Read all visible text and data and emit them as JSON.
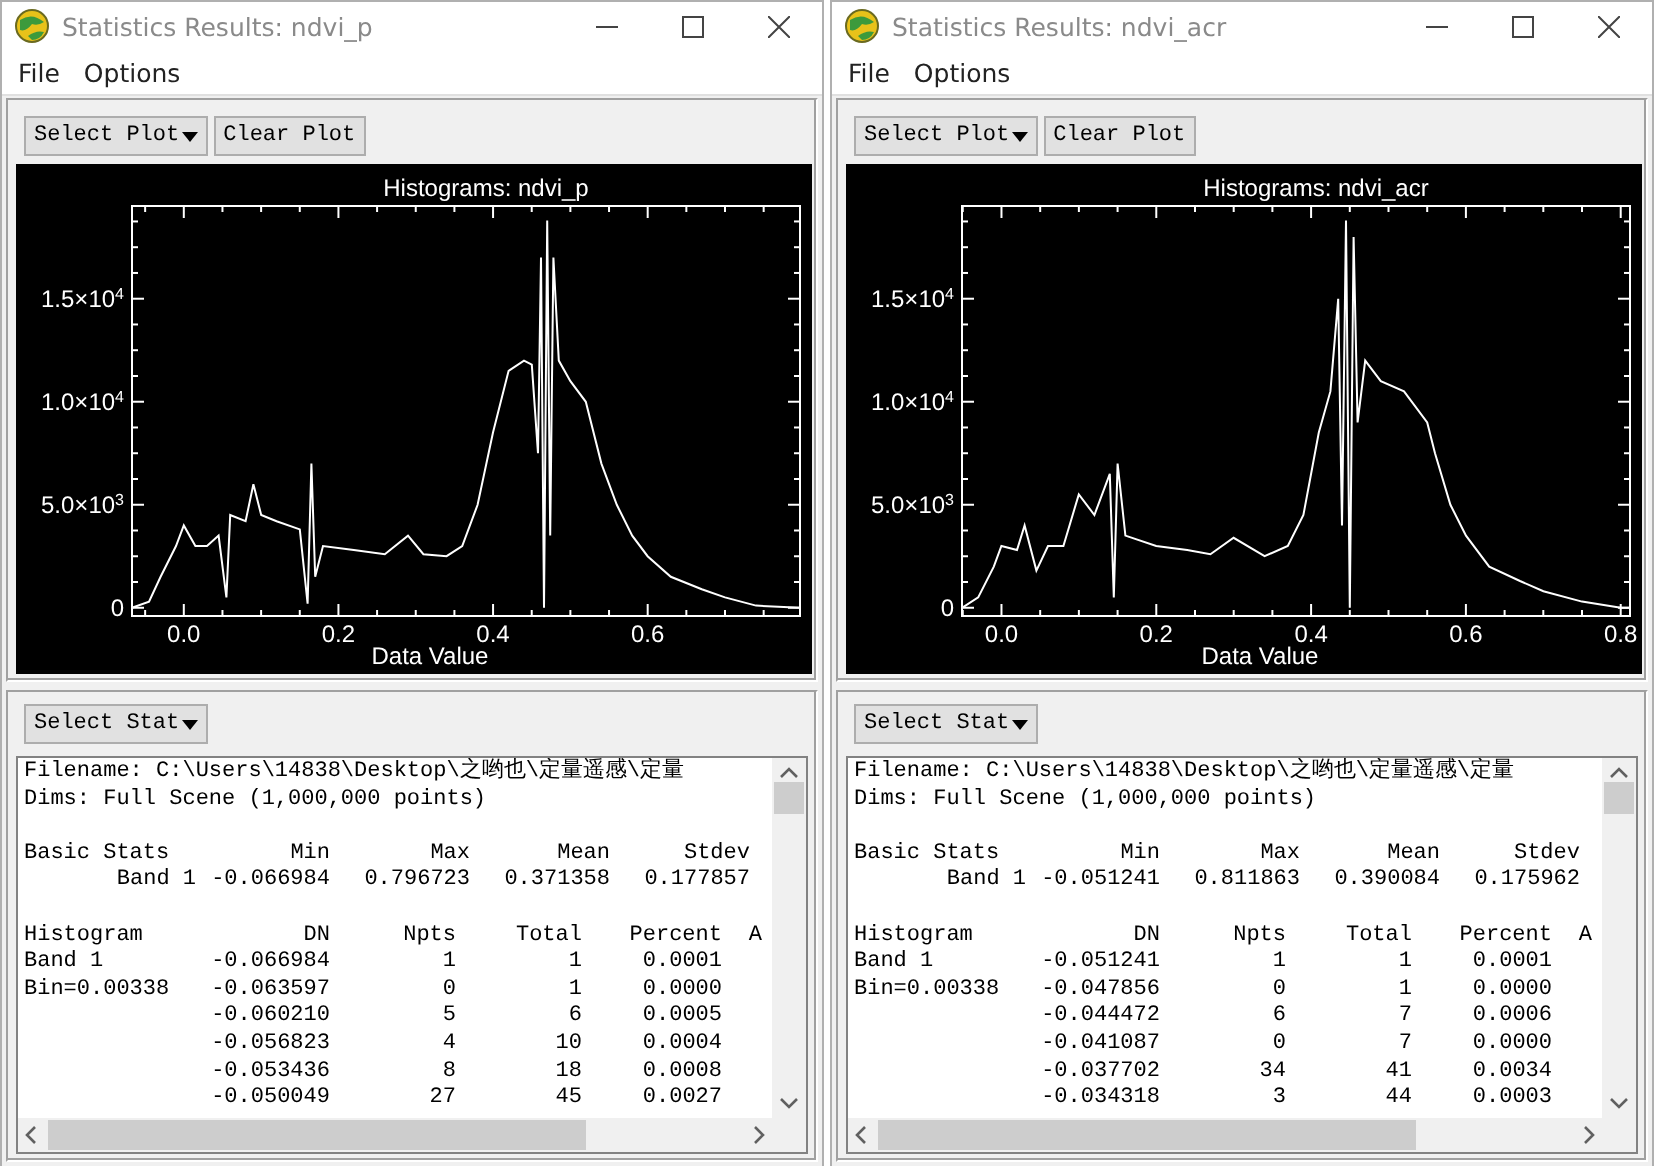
{
  "windows": [
    {
      "title": "Statistics Results: ndvi_p",
      "menu": [
        "File",
        "Options"
      ],
      "plot_buttons": [
        {
          "label": "Select Plot",
          "kind": "dropdown"
        },
        {
          "label": "Clear Plot",
          "kind": "push"
        }
      ],
      "chart_data": {
        "type": "line",
        "title": "Histograms: ndvi_p",
        "xlabel": "Data Value",
        "xlim": [
          -0.067,
          0.797
        ],
        "ylim": [
          -400,
          19500
        ],
        "xticks": [
          {
            "value": 0,
            "label": "0.0"
          },
          {
            "value": 0.2,
            "label": "0.2"
          },
          {
            "value": 0.4,
            "label": "0.4"
          },
          {
            "value": 0.6,
            "label": "0.6"
          }
        ],
        "yticks": [
          {
            "value": 0,
            "label": "0"
          },
          {
            "value": 5000,
            "label": "5.0×10$^{3}$"
          },
          {
            "value": 10000,
            "label": "1.0×10$^{4}$"
          },
          {
            "value": 15000,
            "label": "1.5×10$^{4}$"
          }
        ],
        "x": [
          -0.067,
          -0.045,
          -0.03,
          -0.01,
          0.0,
          0.015,
          0.03,
          0.045,
          0.055,
          0.06,
          0.08,
          0.09,
          0.1,
          0.12,
          0.15,
          0.16,
          0.165,
          0.17,
          0.18,
          0.22,
          0.26,
          0.29,
          0.31,
          0.34,
          0.36,
          0.38,
          0.4,
          0.42,
          0.44,
          0.45,
          0.458,
          0.462,
          0.466,
          0.47,
          0.474,
          0.478,
          0.485,
          0.5,
          0.52,
          0.54,
          0.56,
          0.58,
          0.6,
          0.63,
          0.67,
          0.7,
          0.74,
          0.797
        ],
        "values": [
          0,
          300,
          1500,
          3000,
          4000,
          3000,
          3000,
          3500,
          500,
          4500,
          4200,
          6000,
          4500,
          4200,
          3800,
          200,
          7000,
          1500,
          3000,
          2800,
          2600,
          3500,
          2600,
          2500,
          3000,
          5000,
          8500,
          11500,
          12000,
          11800,
          7500,
          17000,
          0,
          18800,
          3500,
          17000,
          12000,
          11000,
          10000,
          7000,
          5000,
          3500,
          2500,
          1500,
          900,
          500,
          100,
          0
        ]
      },
      "stat_button": {
        "label": "Select Stat"
      },
      "report": {
        "filename": "Filename: C:\\Users\\14838\\Desktop\\之哟也\\定量遥感\\定量",
        "dims": "Dims: Full Scene (1,000,000 points)",
        "basic_stats": {
          "label": "Basic Stats",
          "columns": [
            "Min",
            "Max",
            "Mean",
            "Stdev"
          ],
          "rows": [
            {
              "label": "Band 1",
              "values": [
                "-0.066984",
                "0.796723",
                "0.371358",
                "0.177857"
              ]
            }
          ]
        },
        "histogram": {
          "label": "Histogram",
          "columns": [
            "DN",
            "Npts",
            "Total",
            "Percent",
            "A"
          ],
          "rows": [
            {
              "label": "Band 1",
              "values": [
                "-0.066984",
                "1",
                "1",
                "0.0001"
              ]
            },
            {
              "label": "Bin=0.00338",
              "values": [
                "-0.063597",
                "0",
                "1",
                "0.0000"
              ]
            },
            {
              "values": [
                "-0.060210",
                "5",
                "6",
                "0.0005"
              ]
            },
            {
              "values": [
                "-0.056823",
                "4",
                "10",
                "0.0004"
              ]
            },
            {
              "values": [
                "-0.053436",
                "8",
                "18",
                "0.0008"
              ]
            },
            {
              "values": [
                "-0.050049",
                "27",
                "45",
                "0.0027"
              ]
            }
          ]
        }
      }
    },
    {
      "title": "Statistics Results: ndvi_acr",
      "menu": [
        "File",
        "Options"
      ],
      "plot_buttons": [
        {
          "label": "Select Plot",
          "kind": "dropdown"
        },
        {
          "label": "Clear Plot",
          "kind": "push"
        }
      ],
      "chart_data": {
        "type": "line",
        "title": "Histograms: ndvi_acr",
        "xlabel": "Data Value",
        "xlim": [
          -0.051,
          0.812
        ],
        "ylim": [
          -400,
          19500
        ],
        "xticks": [
          {
            "value": 0,
            "label": "0.0"
          },
          {
            "value": 0.2,
            "label": "0.2"
          },
          {
            "value": 0.4,
            "label": "0.4"
          },
          {
            "value": 0.6,
            "label": "0.6"
          },
          {
            "value": 0.8,
            "label": "0.8"
          }
        ],
        "yticks": [
          {
            "value": 0,
            "label": "0"
          },
          {
            "value": 5000,
            "label": "5.0×10$^{3}$"
          },
          {
            "value": 10000,
            "label": "1.0×10$^{4}$"
          },
          {
            "value": 15000,
            "label": "1.5×10$^{4}$"
          }
        ],
        "x": [
          -0.051,
          -0.03,
          -0.01,
          0.0,
          0.02,
          0.03,
          0.045,
          0.06,
          0.08,
          0.1,
          0.12,
          0.14,
          0.145,
          0.15,
          0.16,
          0.2,
          0.24,
          0.27,
          0.3,
          0.34,
          0.37,
          0.39,
          0.41,
          0.425,
          0.435,
          0.44,
          0.445,
          0.45,
          0.455,
          0.46,
          0.47,
          0.49,
          0.52,
          0.55,
          0.56,
          0.58,
          0.6,
          0.63,
          0.67,
          0.7,
          0.75,
          0.8,
          0.812
        ],
        "values": [
          0,
          500,
          2000,
          3000,
          2800,
          4000,
          1800,
          3000,
          3000,
          5500,
          4500,
          6500,
          500,
          7000,
          3500,
          3000,
          2800,
          2600,
          3400,
          2500,
          3000,
          4500,
          8500,
          10500,
          15000,
          4000,
          18800,
          0,
          18000,
          9000,
          12000,
          11000,
          10500,
          9000,
          7500,
          5000,
          3500,
          2000,
          1300,
          800,
          300,
          0,
          0
        ]
      },
      "stat_button": {
        "label": "Select Stat"
      },
      "report": {
        "filename": "Filename: C:\\Users\\14838\\Desktop\\之哟也\\定量遥感\\定量",
        "dims": "Dims: Full Scene (1,000,000 points)",
        "basic_stats": {
          "label": "Basic Stats",
          "columns": [
            "Min",
            "Max",
            "Mean",
            "Stdev"
          ],
          "rows": [
            {
              "label": "Band 1",
              "values": [
                "-0.051241",
                "0.811863",
                "0.390084",
                "0.175962"
              ]
            }
          ]
        },
        "histogram": {
          "label": "Histogram",
          "columns": [
            "DN",
            "Npts",
            "Total",
            "Percent",
            "A"
          ],
          "rows": [
            {
              "label": "Band 1",
              "values": [
                "-0.051241",
                "1",
                "1",
                "0.0001"
              ]
            },
            {
              "label": "Bin=0.00338",
              "values": [
                "-0.047856",
                "0",
                "1",
                "0.0000"
              ]
            },
            {
              "values": [
                "-0.044472",
                "6",
                "7",
                "0.0006"
              ]
            },
            {
              "values": [
                "-0.041087",
                "0",
                "7",
                "0.0000"
              ]
            },
            {
              "values": [
                "-0.037702",
                "34",
                "41",
                "0.0034"
              ]
            },
            {
              "values": [
                "-0.034318",
                "3",
                "44",
                "0.0003"
              ]
            }
          ]
        }
      }
    }
  ]
}
